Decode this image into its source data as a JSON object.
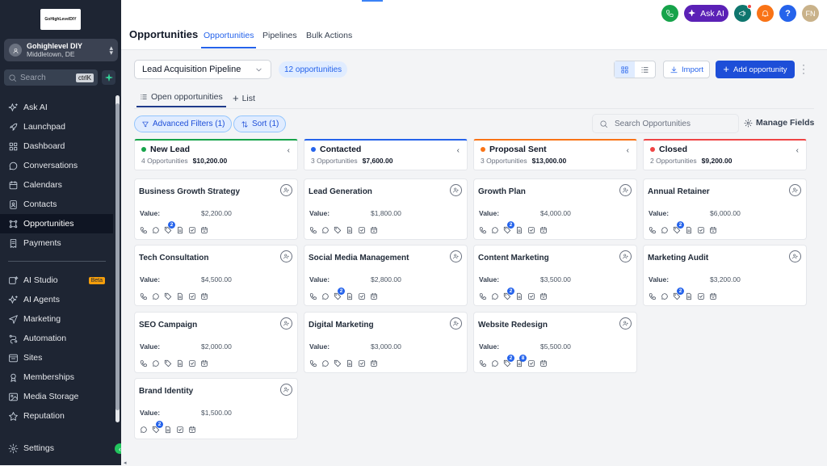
{
  "sidebar": {
    "logo_text": "GoHighLevelDIY",
    "account": {
      "name": "Gohighlevel DIY",
      "location": "Middletown, DE"
    },
    "search": {
      "placeholder": "Search",
      "shortcut": "ctrlK"
    },
    "items": [
      {
        "label": "Ask AI",
        "icon": "sparkles-icon"
      },
      {
        "label": "Launchpad",
        "icon": "rocket-icon"
      },
      {
        "label": "Dashboard",
        "icon": "grid-icon"
      },
      {
        "label": "Conversations",
        "icon": "chat-icon"
      },
      {
        "label": "Calendars",
        "icon": "calendar-icon"
      },
      {
        "label": "Contacts",
        "icon": "contacts-icon"
      },
      {
        "label": "Opportunities",
        "icon": "funnel-icon",
        "active": true
      },
      {
        "label": "Payments",
        "icon": "receipt-icon"
      },
      {
        "label": "AI Studio",
        "icon": "ai-studio-icon",
        "badge": "Beta"
      },
      {
        "label": "AI Agents",
        "icon": "sparkles-icon"
      },
      {
        "label": "Marketing",
        "icon": "send-icon"
      },
      {
        "label": "Automation",
        "icon": "automation-icon"
      },
      {
        "label": "Sites",
        "icon": "sites-icon"
      },
      {
        "label": "Memberships",
        "icon": "memberships-icon"
      },
      {
        "label": "Media Storage",
        "icon": "image-icon"
      },
      {
        "label": "Reputation",
        "icon": "star-icon"
      },
      {
        "label": "Settings",
        "icon": "gear-icon"
      }
    ]
  },
  "header": {
    "title": "Opportunities",
    "tabs": [
      {
        "label": "Opportunities",
        "active": true
      },
      {
        "label": "Pipelines"
      },
      {
        "label": "Bulk Actions"
      }
    ],
    "ask_ai_label": "Ask AI",
    "help_label": "?",
    "user_initials": "FN"
  },
  "toolbar": {
    "pipeline_select": "Lead Acquisition Pipeline",
    "opportunity_count": "12 opportunities",
    "import_label": "Import",
    "add_label": "Add opportunity"
  },
  "view_tabs": {
    "open_label": "Open opportunities",
    "list_label": "List"
  },
  "filters": {
    "advanced_label": "Advanced Filters (1)",
    "sort_label": "Sort (1)",
    "search_placeholder": "Search Opportunities",
    "manage_fields_label": "Manage Fields"
  },
  "value_label": "Value:",
  "columns": [
    {
      "name": "New Lead",
      "color": "#16a34a",
      "count": "4 Opportunities",
      "total": "$10,200.00",
      "cards": [
        {
          "title": "Business Growth Strategy",
          "value": "$2,200.00",
          "icons": [
            "phone",
            "chat",
            "tag2",
            "doc",
            "check",
            "cal"
          ]
        },
        {
          "title": "Tech Consultation",
          "value": "$4,500.00",
          "icons": [
            "phone",
            "chat",
            "tag",
            "doc",
            "check",
            "cal"
          ]
        },
        {
          "title": "SEO Campaign",
          "value": "$2,000.00",
          "icons": [
            "phone",
            "chat",
            "tag",
            "doc",
            "check",
            "cal"
          ]
        },
        {
          "title": "Brand Identity",
          "value": "$1,500.00",
          "icons": [
            "chat",
            "tag2",
            "doc",
            "check",
            "cal"
          ]
        }
      ]
    },
    {
      "name": "Contacted",
      "color": "#2563eb",
      "count": "3 Opportunities",
      "total": "$7,600.00",
      "cards": [
        {
          "title": "Lead Generation",
          "value": "$1,800.00",
          "icons": [
            "phone",
            "chat",
            "tag",
            "doc",
            "check",
            "cal"
          ]
        },
        {
          "title": "Social Media Management",
          "value": "$2,800.00",
          "icons": [
            "phone",
            "chat",
            "tag2",
            "doc",
            "check",
            "cal"
          ]
        },
        {
          "title": "Digital Marketing",
          "value": "$3,000.00",
          "icons": [
            "phone",
            "chat",
            "tag",
            "doc",
            "check",
            "cal"
          ]
        }
      ]
    },
    {
      "name": "Proposal Sent",
      "color": "#f97316",
      "count": "3 Opportunities",
      "total": "$13,000.00",
      "cards": [
        {
          "title": "Growth Plan",
          "value": "$4,000.00",
          "icons": [
            "phone",
            "chat",
            "tag2",
            "doc",
            "check",
            "cal"
          ]
        },
        {
          "title": "Content Marketing",
          "value": "$3,500.00",
          "icons": [
            "phone",
            "chat",
            "tag2",
            "doc",
            "check",
            "cal"
          ]
        },
        {
          "title": "Website Redesign",
          "value": "$5,500.00",
          "icons": [
            "phone",
            "chat",
            "tag2",
            "doc8",
            "check",
            "cal"
          ]
        }
      ]
    },
    {
      "name": "Closed",
      "color": "#ef4444",
      "count": "2 Opportunities",
      "total": "$9,200.00",
      "cards": [
        {
          "title": "Annual Retainer",
          "value": "$6,000.00",
          "icons": [
            "phone",
            "chat",
            "tag2",
            "doc",
            "check",
            "cal"
          ]
        },
        {
          "title": "Marketing Audit",
          "value": "$3,200.00",
          "icons": [
            "phone",
            "chat",
            "tag2",
            "doc",
            "check",
            "cal"
          ]
        }
      ]
    }
  ],
  "badges": {
    "tag2": "2",
    "doc8": "8"
  }
}
